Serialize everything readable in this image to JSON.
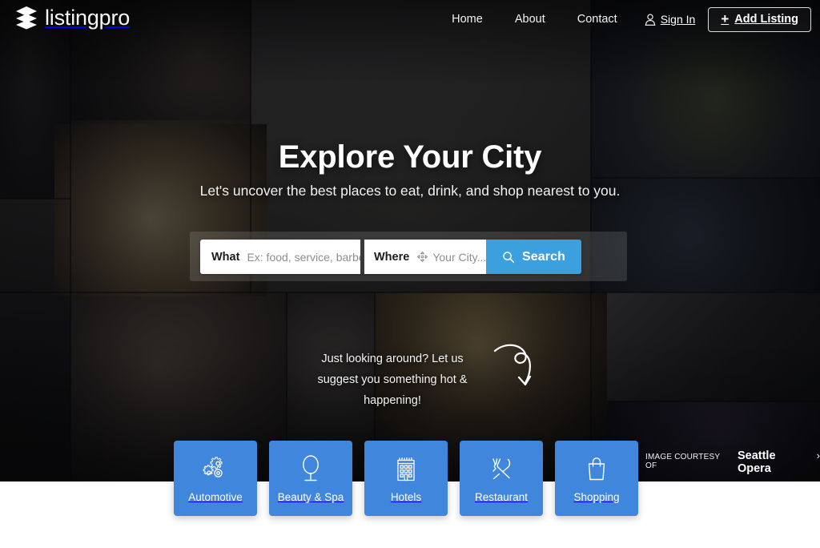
{
  "header": {
    "logo_text": "listingpro",
    "logo_icon": "layers-stack-icon",
    "nav": [
      {
        "label": "Home",
        "name": "nav-home"
      },
      {
        "label": "About",
        "name": "nav-about"
      },
      {
        "label": "Contact",
        "name": "nav-contact"
      }
    ],
    "sign_in": {
      "label": "Sign In",
      "icon": "user-icon"
    },
    "add_listing": {
      "label": "Add Listing",
      "icon": "plus-icon"
    }
  },
  "hero": {
    "headline": "Explore Your City",
    "subheadline": "Let's uncover the best places to eat, drink, and shop nearest to you.",
    "suggest_text": "Just looking around? Let us suggest you something hot & happening!",
    "suggest_arrow_icon": "curly-arrow-down-icon"
  },
  "search": {
    "what_label": "What",
    "what_placeholder": "Ex: food, service, barber,",
    "what_value": "",
    "where_label": "Where",
    "where_placeholder": "Your City...",
    "where_value": "",
    "where_icon": "locate-crosshair-icon",
    "button_label": "Search",
    "button_icon": "magnifier-icon",
    "button_color": "#3ca0de"
  },
  "categories": {
    "tile_color": "#3f86dc",
    "items": [
      {
        "label": "Automotive",
        "icon": "gears-icon"
      },
      {
        "label": "Beauty & Spa",
        "icon": "vanity-mirror-icon"
      },
      {
        "label": "Hotels",
        "icon": "building-icon"
      },
      {
        "label": "Restaurant",
        "icon": "fork-knife-icon"
      },
      {
        "label": "Shopping",
        "icon": "shopping-bag-icon"
      }
    ]
  },
  "image_credit": {
    "prefix": "IMAGE COURTESY OF",
    "name": "Seattle Opera",
    "chevron": "›"
  }
}
